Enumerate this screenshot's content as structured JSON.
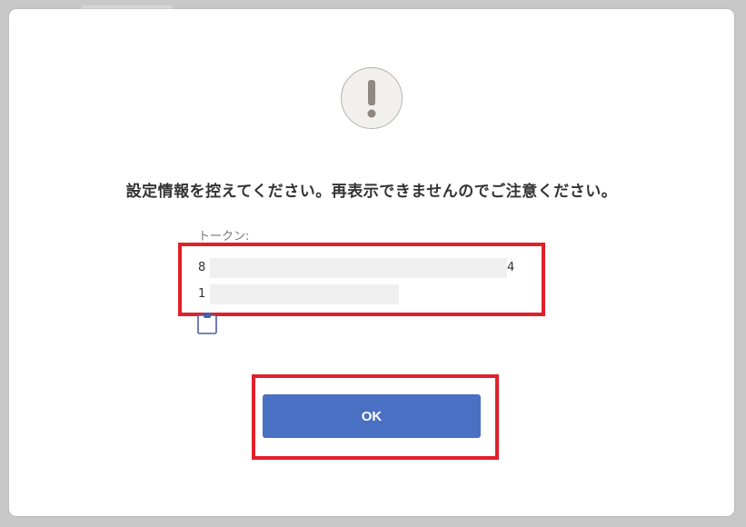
{
  "dialog": {
    "message": "設定情報を控えてください。再表示できませんのでご注意ください。",
    "token": {
      "label": "トークン:",
      "line1_start": "8",
      "line1_end": "4",
      "line2_start": "1"
    },
    "ok_label": "OK"
  },
  "colors": {
    "ok_button": "#4a70c3",
    "highlight": "#e0202a",
    "icon_bg": "#f2f0ee",
    "icon_mark": "#8e8782"
  },
  "icons": {
    "warning": "exclamation-circle-icon",
    "copy": "clipboard-icon"
  }
}
